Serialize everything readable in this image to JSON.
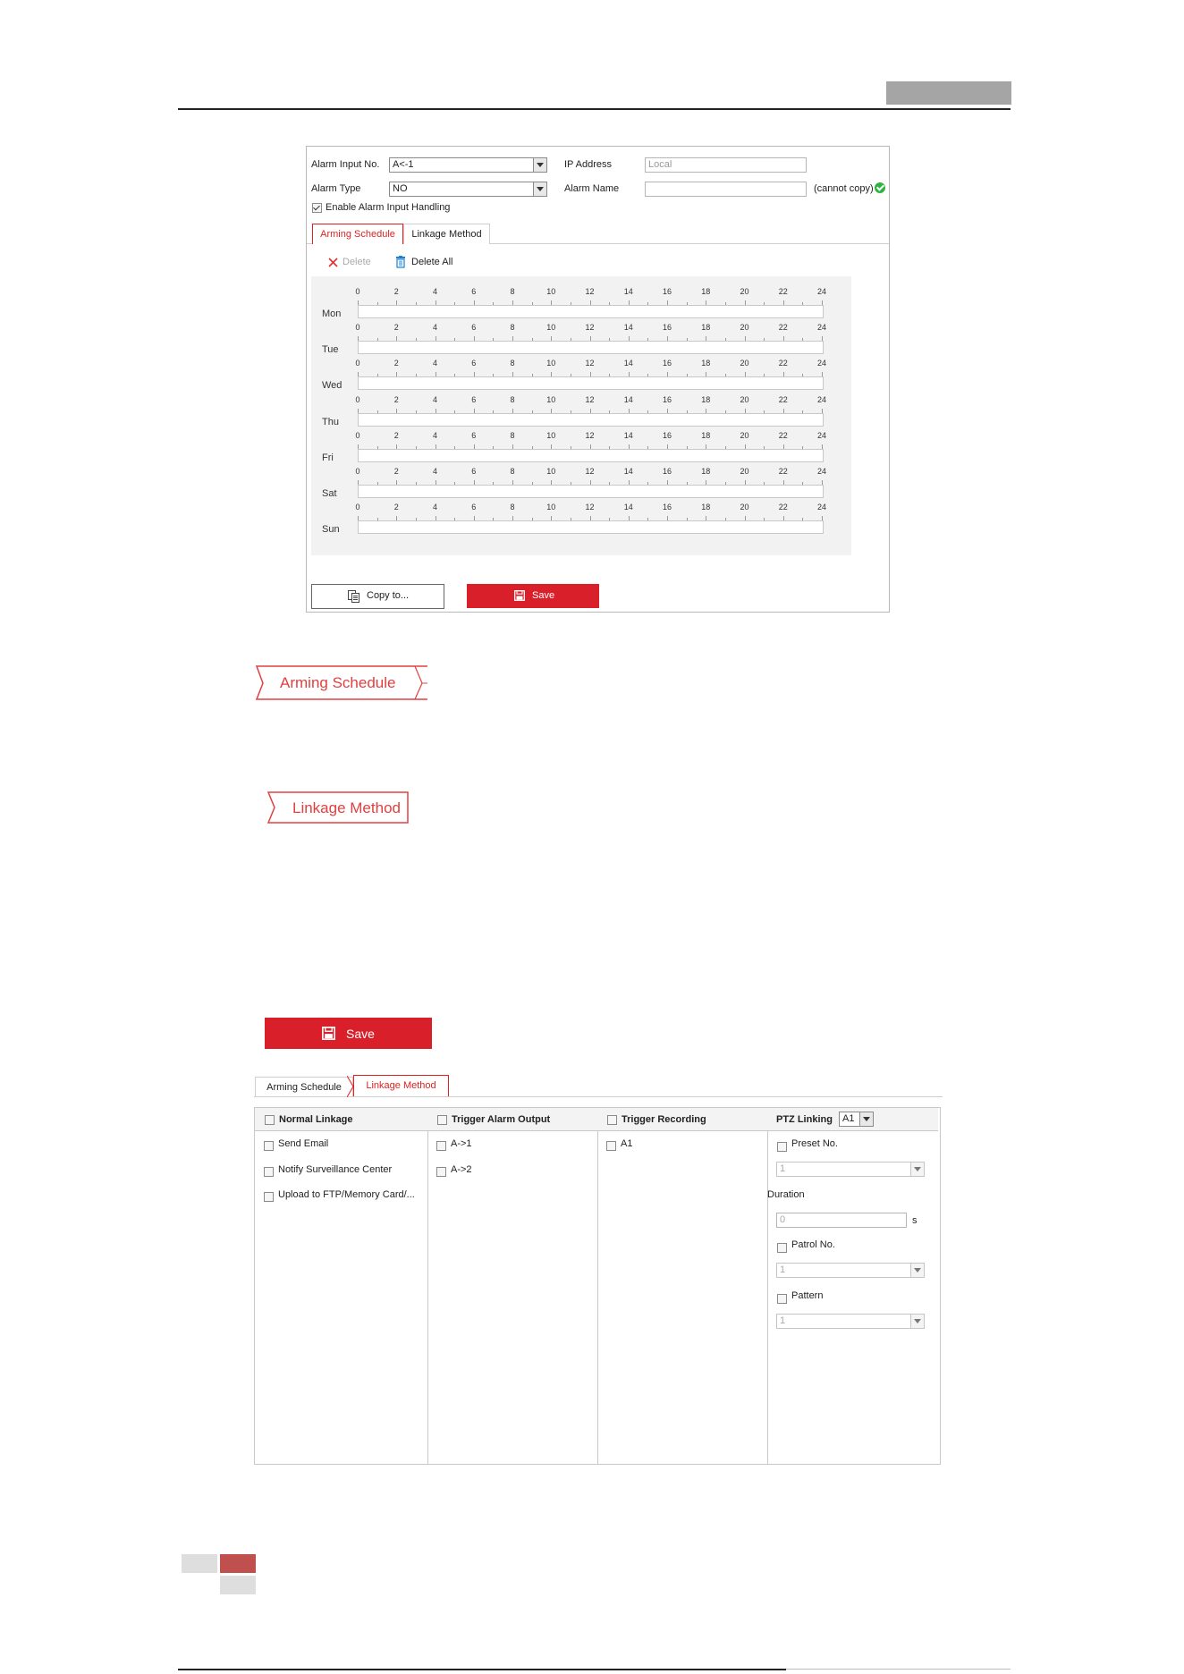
{
  "panel1": {
    "alarm_input_no_label": "Alarm Input No.",
    "alarm_input_no_value": "A<-1",
    "ip_address_label": "IP Address",
    "ip_address_value": "Local",
    "alarm_type_label": "Alarm Type",
    "alarm_type_value": "NO",
    "alarm_name_label": "Alarm Name",
    "alarm_name_value": "",
    "cannot_copy_text": "(cannot copy)",
    "enable_label": "Enable Alarm Input Handling",
    "enable_checked": true,
    "tabs": [
      "Arming Schedule",
      "Linkage Method"
    ],
    "active_tab": "Arming Schedule",
    "delete_label": "Delete",
    "delete_all_label": "Delete All",
    "days": [
      "Mon",
      "Tue",
      "Wed",
      "Thu",
      "Fri",
      "Sat",
      "Sun"
    ],
    "hours": [
      "0",
      "2",
      "4",
      "6",
      "8",
      "10",
      "12",
      "14",
      "16",
      "18",
      "20",
      "22",
      "24"
    ],
    "copy_to_label": "Copy to...",
    "save_label": "Save"
  },
  "standalone": {
    "arming_schedule_tab": "Arming Schedule",
    "linkage_method_tab": "Linkage Method",
    "save_label": "Save"
  },
  "panel2": {
    "tabs": [
      "Arming Schedule",
      "Linkage Method"
    ],
    "active_tab": "Linkage Method",
    "normal_linkage": {
      "header": "Normal Linkage",
      "items": [
        "Send Email",
        "Notify Surveillance Center",
        "Upload to FTP/Memory Card/..."
      ]
    },
    "trigger_alarm_output": {
      "header": "Trigger Alarm Output",
      "items": [
        "A->1",
        "A->2"
      ]
    },
    "trigger_recording": {
      "header": "Trigger Recording",
      "items": [
        "A1"
      ]
    },
    "ptz_linking": {
      "header": "PTZ Linking",
      "channel_value": "A1",
      "preset_label": "Preset No.",
      "preset_value": "1",
      "duration_label": "Duration",
      "duration_value": "0",
      "duration_unit": "s",
      "patrol_label": "Patrol No.",
      "patrol_value": "1",
      "pattern_label": "Pattern",
      "pattern_value": "1"
    }
  },
  "colors": {
    "accent_red": "#d9202a",
    "tab_red": "#e02020",
    "ok_green": "#2fb33f"
  }
}
